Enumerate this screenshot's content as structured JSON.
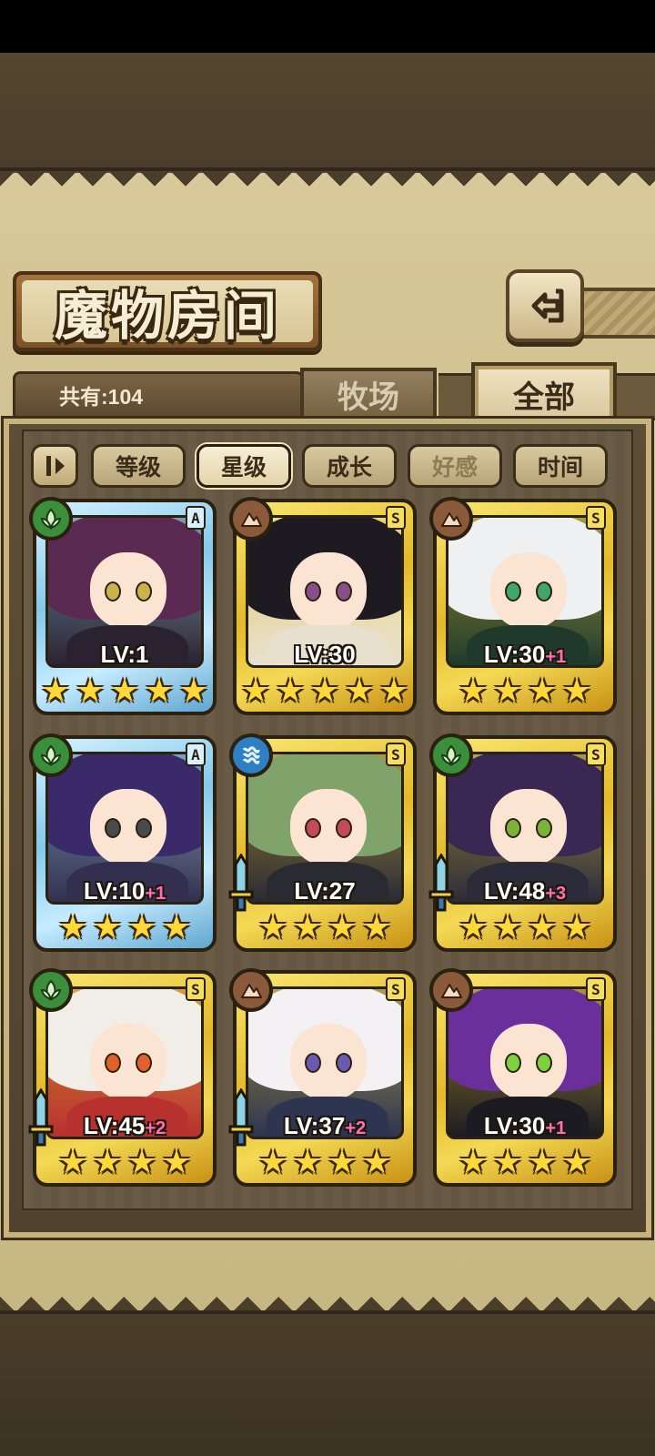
{
  "header": {
    "title": "魔物房间",
    "count_label": "共有:104"
  },
  "tabs": [
    {
      "label": "牧场",
      "active": false
    },
    {
      "label": "全部",
      "active": true
    }
  ],
  "sort_buttons": [
    {
      "label": "等级",
      "active": false
    },
    {
      "label": "星级",
      "active": true
    },
    {
      "label": "成长",
      "active": false
    },
    {
      "label": "好感",
      "active": false
    },
    {
      "label": "时间",
      "active": false
    }
  ],
  "cards": [
    {
      "rank": "A",
      "frame": "blue",
      "element": "leaf",
      "level": "LV:1",
      "plus": "",
      "stars": 5,
      "weapon": false,
      "hair": "#5a2a52",
      "body": "#2a2230",
      "eye": "#c9b34a"
    },
    {
      "rank": "S",
      "frame": "gold",
      "element": "earth",
      "level": "LV:30",
      "plus": "",
      "stars": 5,
      "weapon": false,
      "hair": "#1e1a22",
      "body": "#e8e0cf",
      "eye": "#8a4f8a"
    },
    {
      "rank": "S",
      "frame": "gold",
      "element": "earth",
      "level": "LV:30",
      "plus": "+1",
      "stars": 4,
      "weapon": false,
      "hair": "#eef0f2",
      "body": "#1f3a2c",
      "eye": "#3fa76a"
    },
    {
      "rank": "A",
      "frame": "blue",
      "element": "leaf",
      "level": "LV:10",
      "plus": "+1",
      "stars": 4,
      "weapon": false,
      "hair": "#3b2a6a",
      "body": "#33304f",
      "eye": "#4a4a4a"
    },
    {
      "rank": "S",
      "frame": "gold",
      "element": "water",
      "level": "LV:27",
      "plus": "",
      "stars": 4,
      "weapon": true,
      "hair": "#7fa36a",
      "body": "#2a2a33",
      "eye": "#c24a5a"
    },
    {
      "rank": "S",
      "frame": "gold",
      "element": "leaf",
      "level": "LV:48",
      "plus": "+3",
      "stars": 4,
      "weapon": true,
      "hair": "#3b2754",
      "body": "#2c2b3a",
      "eye": "#7bb33a"
    },
    {
      "rank": "S",
      "frame": "gold",
      "element": "leaf",
      "level": "LV:45",
      "plus": "+2",
      "stars": 4,
      "weapon": true,
      "hair": "#f1eee8",
      "body": "#b7312e",
      "eye": "#e0612a"
    },
    {
      "rank": "S",
      "frame": "gold",
      "element": "earth",
      "level": "LV:37",
      "plus": "+2",
      "stars": 4,
      "weapon": true,
      "hair": "#f3f1f4",
      "body": "#2d3550",
      "eye": "#6a5ab0"
    },
    {
      "rank": "S",
      "frame": "gold",
      "element": "earth",
      "level": "LV:30",
      "plus": "+1",
      "stars": 4,
      "weapon": false,
      "hair": "#6a2f9a",
      "body": "#1d1b22",
      "eye": "#7bd23a"
    }
  ],
  "icons": {
    "back": "back-arrow-icon",
    "sort_toggle": "sort-order-icon",
    "leaf": "leaf-element-icon",
    "earth": "earth-element-icon",
    "water": "water-element-icon",
    "weapon": "sword-icon",
    "star": "star-icon"
  }
}
